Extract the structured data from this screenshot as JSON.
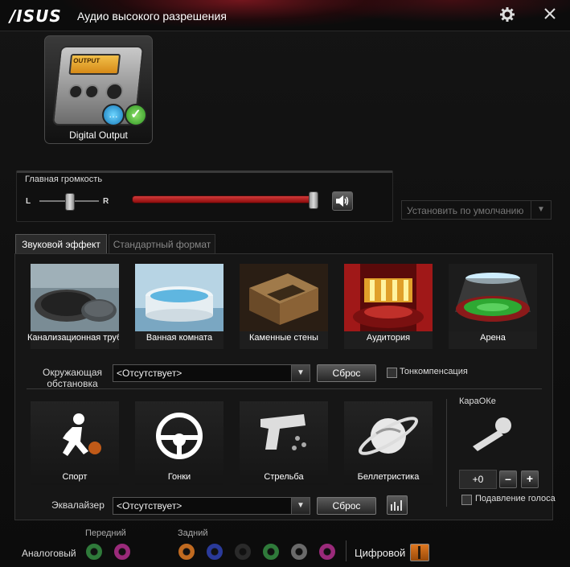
{
  "window": {
    "logo": "/ISUS",
    "title": "Аудио высокого разрешения",
    "settings_icon": "gear-icon",
    "close_icon": "close-icon"
  },
  "device": {
    "label": "Digital Output",
    "screen_text": "OUTPUT"
  },
  "volume": {
    "title": "Главная громкость",
    "left_label": "L",
    "right_label": "R",
    "balance_percent": 50,
    "level_percent": 100,
    "mute_icon": "speaker-icon"
  },
  "default_button": "Установить по умолчанию",
  "tabs": [
    "Звуковой эффект",
    "Стандартный формат"
  ],
  "environments": [
    {
      "label": "Канализационная труба"
    },
    {
      "label": "Ванная комната"
    },
    {
      "label": "Каменные стены"
    },
    {
      "label": "Аудитория"
    },
    {
      "label": "Арена"
    }
  ],
  "environment_row": {
    "label_line1": "Окружающая",
    "label_line2": "обстановка",
    "selected": "<Отсутствует>",
    "reset": "Сброс",
    "loudness": "Тонкомпенсация"
  },
  "activities": [
    {
      "label": "Спорт",
      "icon": "sport-icon"
    },
    {
      "label": "Гонки",
      "icon": "steering-wheel-icon"
    },
    {
      "label": "Стрельба",
      "icon": "pistol-icon"
    },
    {
      "label": "Беллетристика",
      "icon": "planet-icon"
    }
  ],
  "karaoke": {
    "title": "КараОКе",
    "value": "+0",
    "minus": "–",
    "plus": "+",
    "suppress": "Подавление голоса"
  },
  "equalizer": {
    "label": "Эквалайзер",
    "selected": "<Отсутствует>",
    "reset": "Сброс"
  },
  "footer": {
    "analog": "Аналоговый",
    "front": "Передний",
    "back": "Задний",
    "digital": "Цифровой",
    "front_jack_colors": [
      "#2f7a3a",
      "#9a2a7a"
    ],
    "back_jack_colors": [
      "#c06a20",
      "#2a3a9a",
      "#2a2a2a",
      "#2f7a3a",
      "#6a6a6a",
      "#9a2a7a"
    ]
  }
}
